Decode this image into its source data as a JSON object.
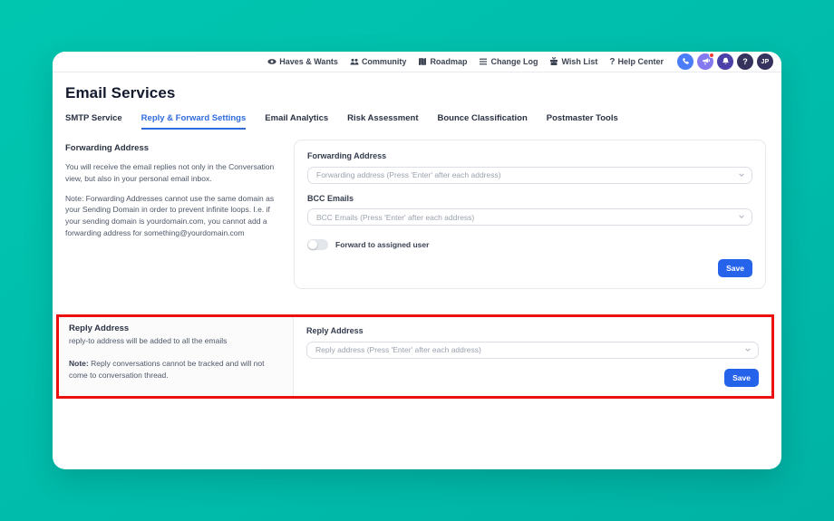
{
  "nav": {
    "items": [
      {
        "label": "Haves & Wants"
      },
      {
        "label": "Community"
      },
      {
        "label": "Roadmap"
      },
      {
        "label": "Change Log"
      },
      {
        "label": "Wish List"
      },
      {
        "label": "Help Center"
      }
    ],
    "help_prefix": "?",
    "icon_buttons": {
      "question_label": "?",
      "avatar_initials": "JP"
    }
  },
  "page": {
    "title": "Email Services"
  },
  "tabs": [
    {
      "label": "SMTP Service",
      "active": false
    },
    {
      "label": "Reply & Forward Settings",
      "active": true
    },
    {
      "label": "Email Analytics",
      "active": false
    },
    {
      "label": "Risk Assessment",
      "active": false
    },
    {
      "label": "Bounce Classification",
      "active": false
    },
    {
      "label": "Postmaster Tools",
      "active": false
    }
  ],
  "forwarding_section": {
    "heading": "Forwarding Address",
    "description_1": "You will receive the email replies not only in the Conversation view, but also in your personal email inbox.",
    "description_2": "Note: Forwarding Addresses cannot use the same domain as your Sending Domain in order to prevent infinite loops. I.e. if your sending domain is yourdomain.com, you cannot add a forwarding address for something@yourdomain.com",
    "form": {
      "forwarding_label": "Forwarding Address",
      "forwarding_placeholder": "Forwarding address (Press 'Enter' after each address)",
      "bcc_label": "BCC Emails",
      "bcc_placeholder": "BCC Emails (Press 'Enter' after each address)",
      "toggle_label": "Forward to assigned user",
      "save_label": "Save"
    }
  },
  "reply_section": {
    "heading": "Reply Address",
    "description": "reply-to address will be added to all the emails",
    "note_prefix": "Note:",
    "note_text": " Reply conversations cannot be tracked and will not come to conversation thread.",
    "form": {
      "reply_label": "Reply Address",
      "reply_placeholder": "Reply address (Press 'Enter' after each address)",
      "save_label": "Save"
    }
  },
  "colors": {
    "accent_blue": "#2563eb",
    "active_tab_blue": "#2f6bdf",
    "highlight_red": "#ec1111",
    "background_teal": "#00bcab"
  }
}
